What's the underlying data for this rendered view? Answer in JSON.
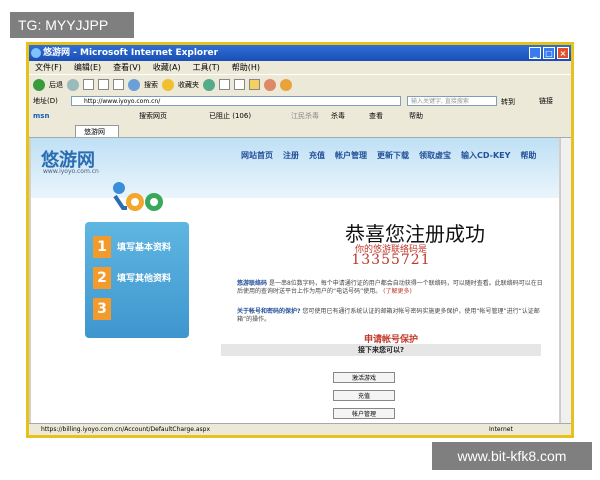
{
  "watermark_top": "TG: MYYJJPP",
  "watermark_bottom": "www.bit-kfk8.com",
  "window": {
    "title": "悠游网 - Microsoft Internet Explorer"
  },
  "menu": [
    "文件(F)",
    "编辑(E)",
    "查看(V)",
    "收藏(A)",
    "工具(T)",
    "帮助(H)"
  ],
  "toolbar": {
    "back": "后退",
    "search": "搜索",
    "favorites": "收藏夹"
  },
  "address": {
    "label": "地址(D)",
    "url": "http://www.iyoyo.com.cn/",
    "go": "转到",
    "links": "链接",
    "search_placeholder": "输入关键字, 直接搜索"
  },
  "msn": {
    "logo": "msn",
    "search_web": "搜索网页",
    "blocked": "已阻止 (106)",
    "antivirus": "江民杀毒",
    "kill": "杀毒",
    "query": "查看",
    "help": "帮助"
  },
  "tab": {
    "label": "悠游网"
  },
  "site": {
    "logo": "悠游网",
    "logo_sub": "www.iyoyo.com.cn",
    "nav": [
      "网站首页",
      "注册",
      "充值",
      "帐户管理",
      "更新下载",
      "领取虚宝",
      "输入CD-KEY",
      "帮助"
    ],
    "steps": [
      {
        "num": "1",
        "label": "填写基本资料"
      },
      {
        "num": "2",
        "label": "填写其他资料"
      },
      {
        "num": "3",
        "label": ""
      }
    ],
    "success_title": "恭喜您注册成功",
    "code_label": "你的悠游联络码是",
    "code": "13355721",
    "para1_hl": "悠游联络码",
    "para1": "是一串8位数字码，每个申请通行证的用户都会自动获得一个联络码，可以随时查看。此联络码可以在日后使用的查询时送平台上作为用户的“电话号码”使用。",
    "para1_more": "(了解更多)",
    "para2_hl": "关于帐号和密码的保护?",
    "para2": "您可使用已有通行系统认证的邮箱对帐号密码实施更多保护，使用“帐号管理”进行“认证邮箱”的操作。",
    "apply": "申请帐号保护",
    "next": "接下来您可以?",
    "buttons": [
      "激活游戏",
      "充值",
      "帐户管理"
    ]
  },
  "status": {
    "url": "https://billing.iyoyo.com.cn/Account/DefaultCharge.aspx",
    "zone": "Internet"
  }
}
